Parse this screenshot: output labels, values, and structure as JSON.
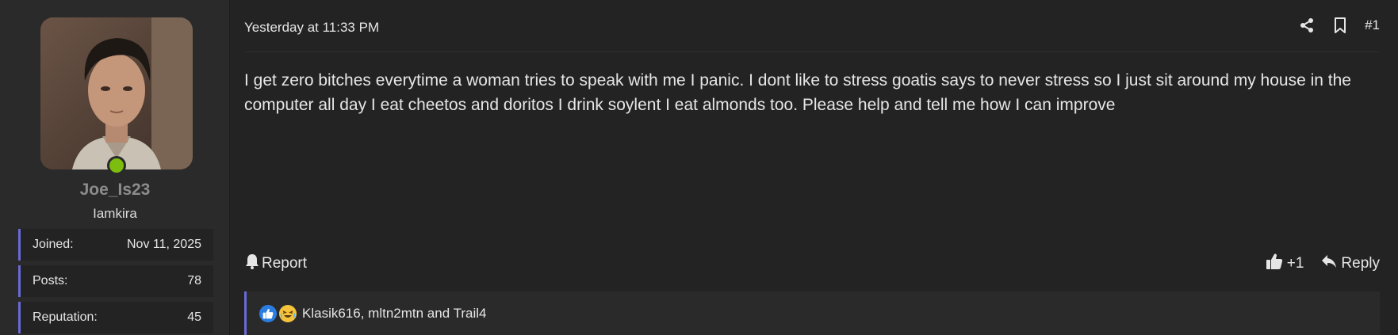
{
  "user": {
    "username": "Joe_Is23",
    "title": "Iamkira",
    "stats": [
      {
        "label": "Joined:",
        "value": "Nov 11, 2025"
      },
      {
        "label": "Posts:",
        "value": "78"
      },
      {
        "label": "Reputation:",
        "value": "45"
      }
    ]
  },
  "post": {
    "date": "Yesterday at 11:33 PM",
    "number": "#1",
    "body": "I get zero bitches everytime a woman tries to speak with me I panic. I dont like to stress goatis says to never stress so I just sit around my house in the computer all day I eat cheetos and doritos I drink soylent I eat almonds too. Please help and tell me how I can improve",
    "report_label": "Report",
    "like_label": "+1",
    "reply_label": "Reply",
    "reactions_text": "Klasik616, mltn2mtn and Trail4"
  },
  "icons": {
    "share": "share-icon",
    "bookmark": "bookmark-icon",
    "bell": "bell-icon",
    "thumbs_up": "thumbs-up-icon",
    "reply": "reply-icon",
    "like_reaction": "like-reaction-icon",
    "laugh_reaction": "laugh-reaction-icon"
  },
  "colors": {
    "accent": "#6a6ad8",
    "online": "#7cbd10",
    "like_blue": "#2a7de1"
  }
}
